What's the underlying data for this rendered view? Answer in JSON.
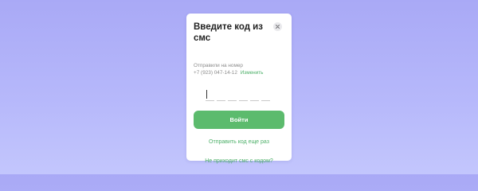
{
  "modal": {
    "title": "Введите код из смс",
    "close_icon": "close-icon",
    "sent_label": "Отправили на номер",
    "phone": "+7 (923) 047-14-12",
    "change_link": "Изменить",
    "code": {
      "length": 6,
      "value": ""
    },
    "submit_label": "Войти",
    "resend_label": "Отправить код еще раз",
    "no_sms_label": "Не приходит смс с кодом?"
  },
  "colors": {
    "accent": "#5cbb6d",
    "link": "#4caf68",
    "background_top": "#a9a9f6",
    "background_bottom": "#c3c6fd"
  }
}
